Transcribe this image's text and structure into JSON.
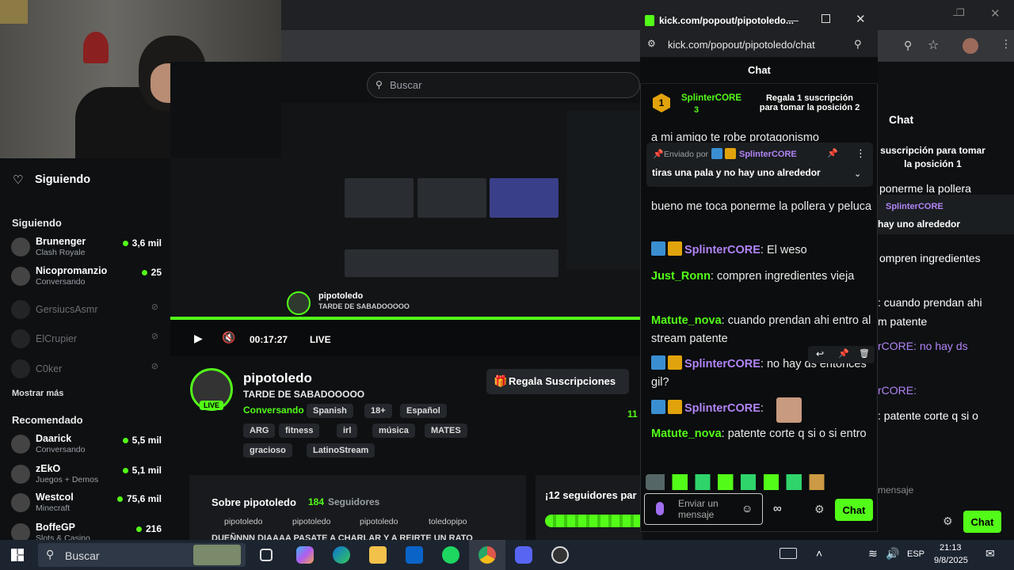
{
  "webcam": {},
  "browser": {
    "search_placeholder": "Buscar"
  },
  "sidebar": {
    "following_title": "Siguiendo",
    "section_following": "Siguiendo",
    "following": [
      {
        "name": "Brunenger",
        "sub": "Clash Royale",
        "viewers": "3,6 mil",
        "online": true
      },
      {
        "name": "Nicopromanzio",
        "sub": "Conversando",
        "viewers": "25",
        "online": true
      },
      {
        "name": "GersiucsAsmr",
        "sub": "",
        "viewers": "",
        "online": false
      },
      {
        "name": "ElCrupier",
        "sub": "",
        "viewers": "",
        "online": false
      },
      {
        "name": "C0ker",
        "sub": "",
        "viewers": "",
        "online": false
      }
    ],
    "show_more": "Mostrar más",
    "section_recommended": "Recomendado",
    "recommended": [
      {
        "name": "Daarick",
        "sub": "Conversando",
        "viewers": "5,5 mil"
      },
      {
        "name": "zEkO",
        "sub": "Juegos + Demos",
        "viewers": "5,1 mil"
      },
      {
        "name": "Westcol",
        "sub": "Minecraft",
        "viewers": "75,6 mil"
      },
      {
        "name": "BoffeGP",
        "sub": "Slots & Casino",
        "viewers": "216"
      }
    ]
  },
  "player": {
    "time": "00:17:27",
    "live": "LIVE"
  },
  "channel": {
    "name": "pipotoledo",
    "title": "TARDE DE SABADOOOOO",
    "category": "Conversando",
    "tags_row1": [
      "Spanish",
      "18+",
      "Español"
    ],
    "tags_row2": [
      "ARG",
      "fitness",
      "irl",
      "música",
      "MATES"
    ],
    "tags_row3": [
      "gracioso",
      "LatinoStream"
    ],
    "live_badge": "LIVE",
    "gift_button": "Regala Suscripciones",
    "viewers_partial": "11",
    "about_title": "Sobre pipotoledo",
    "followers": "184",
    "followers_label": "Seguidores",
    "socials": [
      "pipotoledo",
      "pipotoledo",
      "pipotoledo",
      "toledopipo"
    ],
    "about_text": "DUEÑNNN DIAAAA PASATE A CHARLAR Y A REIRTE UN RATO",
    "goal_text": "¡12 seguidores par"
  },
  "popout": {
    "window_title": "kick.com/popout/pipotoledo...",
    "url": "kick.com/popout/pipotoledo/chat",
    "chat_header": "Chat",
    "top_gifter": {
      "rank": "1",
      "name": "SplinterCORE",
      "count": "3"
    },
    "top_gift_cta": "Regala 1 suscripción para tomar la posición 2",
    "cut_message": "a mi amigo te robe protagonismo",
    "pinned": {
      "sent_by": "Enviado por",
      "user": "SplinterCORE",
      "text": "tiras una pala y no hay uno alrededor"
    },
    "cut_message_2": "bueno me toca ponerme la pollera y peluca",
    "messages": [
      {
        "user": "SplinterCORE",
        "color": "#b184f5",
        "text": "El weso",
        "badges": true
      },
      {
        "user": "Just_Ronn",
        "color": "#53fc18",
        "text": "compren ingredientes vieja",
        "badges": false
      },
      {
        "user": "Matute_nova",
        "color": "#53fc18",
        "text": "cuando prendan ahi entro al stream patente",
        "badges": false
      },
      {
        "user": "SplinterCORE",
        "color": "#b184f5",
        "text": "no hay ds entonces gil?",
        "badges": true
      },
      {
        "user": "SplinterCORE",
        "color": "#b184f5",
        "text": "",
        "badges": true
      },
      {
        "user": "Matute_nova",
        "color": "#53fc18",
        "text": "patente corte q si o si entro",
        "badges": false
      }
    ],
    "input_placeholder": "Enviar un mensaje",
    "send_button": "Chat"
  },
  "right_chat": {
    "header": "Chat",
    "gift_cta": "suscripción para tomar la posición 1",
    "pinned_user": "SplinterCORE",
    "pinned_text": "hay uno alrededor",
    "lines": [
      "ponerme la pollera",
      "ompren ingredientes",
      ": cuando prendan ahi",
      "m patente",
      "rCORE: no hay ds",
      "rCORE:",
      ": patente corte q si o"
    ],
    "input_placeholder": "mensaje",
    "send_button": "Chat"
  },
  "taskbar": {
    "search_placeholder": "Buscar",
    "time": "21:13",
    "date": "9/8/2025",
    "lang": "ESP"
  },
  "colors": {
    "kick_green": "#53fc18",
    "bg": "#0e1012",
    "purple_user": "#b184f5"
  }
}
